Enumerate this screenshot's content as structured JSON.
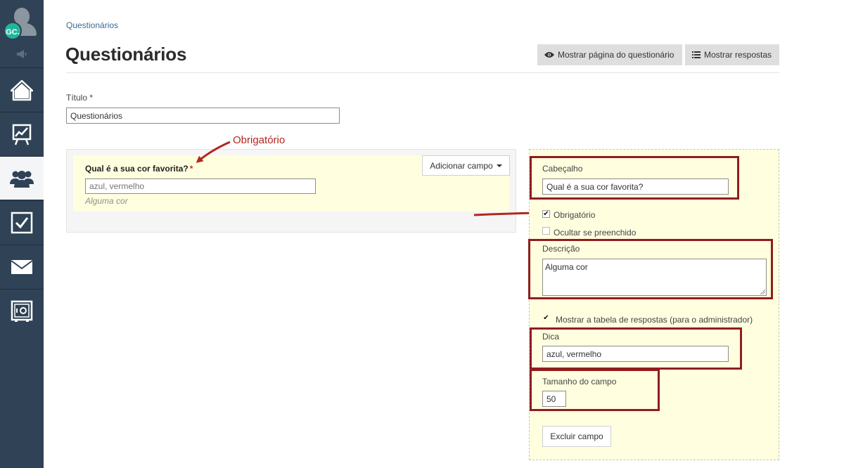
{
  "user": {
    "initials": "GC."
  },
  "sidebar": {
    "items": [
      {
        "icon": "home-icon",
        "active": false
      },
      {
        "icon": "chart-icon",
        "active": false
      },
      {
        "icon": "users-icon",
        "active": true
      },
      {
        "icon": "checkbox-icon",
        "active": false
      },
      {
        "icon": "mail-icon",
        "active": false
      },
      {
        "icon": "safe-icon",
        "active": false
      }
    ]
  },
  "breadcrumb": "Questionários",
  "page_title": "Questionários",
  "header_buttons": {
    "show_page": "Mostrar página do questionário",
    "show_answers": "Mostrar respostas"
  },
  "form": {
    "title_label": "Título *",
    "title_value": "Questionários"
  },
  "preview": {
    "question": "Qual é a sua cor favorita?",
    "required_mark": "*",
    "placeholder": "azul, vermelho",
    "description": "Alguma cor",
    "add_field_label": "Adicionar campo"
  },
  "annotation": {
    "label": "Obrigatório",
    "color": "#b3261e"
  },
  "editor": {
    "header_label": "Cabeçalho",
    "header_value": "Qual é a sua cor favorita?",
    "required_label": "Obrigatório",
    "required_checked": true,
    "hide_if_filled_label": "Ocultar se preenchido",
    "hide_if_filled_checked": false,
    "description_label": "Descrição",
    "description_value": "Alguma cor",
    "show_table_label": "Mostrar a tabela de respostas (para o administrador)",
    "show_table_checked": true,
    "hint_label": "Dica",
    "hint_value": "azul, vermelho",
    "size_label": "Tamanho do campo",
    "size_value": "50",
    "delete_label": "Excluir campo"
  },
  "colors": {
    "sidebar_bg": "#2f4256",
    "highlight": "#8f1d1d",
    "panel_bg": "#ffffe0",
    "link": "#3a6b94",
    "avatar_badge": "#1fb69c"
  }
}
